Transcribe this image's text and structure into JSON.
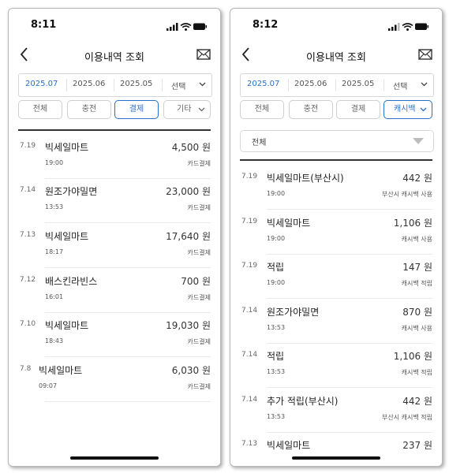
{
  "left": {
    "status_time": "8:11",
    "title": "이용내역 조회",
    "dates": [
      "2025.07",
      "2025.06",
      "2025.05",
      "선택"
    ],
    "tabs": [
      "전체",
      "충전",
      "결제",
      "기타"
    ],
    "rows": [
      {
        "date": "7.19",
        "merchant": "빅세일마트",
        "amount": "4,500 원",
        "time": "19:00",
        "type": "카드결제"
      },
      {
        "date": "7.14",
        "merchant": "원조가야밀면",
        "amount": "23,000 원",
        "time": "13:53",
        "type": "카드결제"
      },
      {
        "date": "7.13",
        "merchant": "빅세일마트",
        "amount": "17,640 원",
        "time": "18:17",
        "type": "카드결제"
      },
      {
        "date": "7.12",
        "merchant": "배스킨라빈스",
        "amount": "700 원",
        "time": "16:01",
        "type": "카드결제"
      },
      {
        "date": "7.10",
        "merchant": "빅세일마트",
        "amount": "19,030 원",
        "time": "18:43",
        "type": "카드결제"
      },
      {
        "date": "7.8",
        "merchant": "빅세일마트",
        "amount": "6,030 원",
        "time": "09:07",
        "type": "카드결제"
      }
    ]
  },
  "right": {
    "status_time": "8:12",
    "title": "이용내역 조회",
    "dates": [
      "2025.07",
      "2025.06",
      "2025.05",
      "선택"
    ],
    "tabs": [
      "전체",
      "충전",
      "결제",
      "캐시백"
    ],
    "filter_value": "전체",
    "rows": [
      {
        "date": "7.19",
        "merchant": "빅세일마트(부산시)",
        "amount": "442 원",
        "time": "19:00",
        "type": "부산시 캐시백 사용"
      },
      {
        "date": "7.19",
        "merchant": "빅세일마트",
        "amount": "1,106 원",
        "time": "19:00",
        "type": "캐시백 사용"
      },
      {
        "date": "7.19",
        "merchant": "적립",
        "amount": "147 원",
        "time": "19:00",
        "type": "캐시백 적립"
      },
      {
        "date": "7.14",
        "merchant": "원조가야밀면",
        "amount": "870 원",
        "time": "13:53",
        "type": "캐시백 사용"
      },
      {
        "date": "7.14",
        "merchant": "적립",
        "amount": "1,106 원",
        "time": "13:53",
        "type": "캐시백 적립"
      },
      {
        "date": "7.14",
        "merchant": "추가 적립(부산시)",
        "amount": "442 원",
        "time": "13:53",
        "type": "부산시 캐시백 적립"
      },
      {
        "date": "7.13",
        "merchant": "빅세일마트",
        "amount": "237 원",
        "time": "",
        "type": ""
      }
    ]
  },
  "colors": {
    "accent": "#2a6fc9",
    "divider": "#333333",
    "border": "#d8d8d8"
  },
  "icons": {
    "back": "chevron-left-icon",
    "mail": "envelope-icon",
    "dropdown": "chevron-down-icon"
  }
}
